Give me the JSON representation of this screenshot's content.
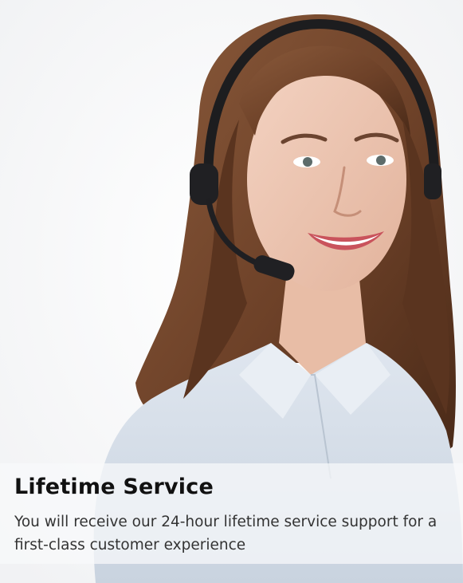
{
  "card": {
    "title": "Lifetime Service",
    "description": "You will receive our 24-hour lifetime service support for a first-class customer experience",
    "image": {
      "subject": "customer-service-agent-with-headset"
    },
    "colors": {
      "caption_background": "#f8f9fb",
      "title_text": "#111111",
      "description_text": "#333333"
    }
  }
}
